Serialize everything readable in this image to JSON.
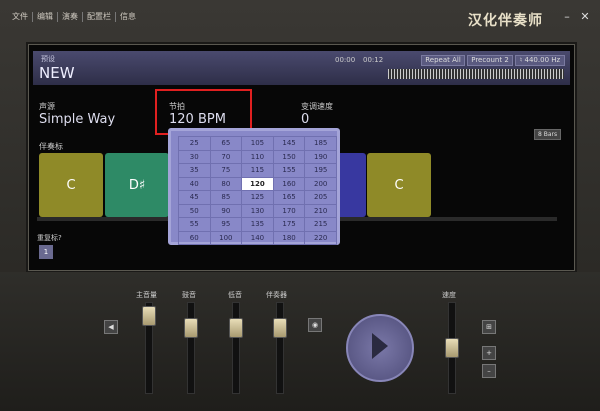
{
  "menu": [
    "文件",
    "编辑",
    "演奏",
    "配置栏",
    "信息"
  ],
  "app_title": "汉化伴奏师",
  "window_controls": {
    "minimize": "–",
    "close": "✕"
  },
  "header": {
    "preset_label": "预设",
    "preset_name": "NEW",
    "time_start": "00:00",
    "time_end": "00:12",
    "repeat_button": "Repeat All",
    "precount_button": "Precount 2",
    "tuning_button": "♮ 440.00 Hz"
  },
  "params": {
    "source_label": "声源",
    "source_value": "Simple Way",
    "beat_label": "节拍",
    "beat_value": "120 BPM",
    "speed_label": "变调速度",
    "speed_value": "0"
  },
  "bars_badge": "8 Bars",
  "accomp_label": "伴奏标",
  "chords": [
    {
      "name": "C",
      "color": "#8f8a28"
    },
    {
      "name": "D♯",
      "color": "#2e8a66"
    },
    {
      "name": "",
      "color": "#3838a0"
    },
    {
      "name": "C",
      "color": "#8f8a28"
    }
  ],
  "repeat_label": "重复标?",
  "repeat_value": "1",
  "tempo_grid": {
    "selected": "120",
    "rows": [
      [
        "25",
        "65",
        "105",
        "145",
        "185"
      ],
      [
        "30",
        "70",
        "110",
        "150",
        "190"
      ],
      [
        "35",
        "75",
        "115",
        "155",
        "195"
      ],
      [
        "40",
        "80",
        "120",
        "160",
        "200"
      ],
      [
        "45",
        "85",
        "125",
        "165",
        "205"
      ],
      [
        "50",
        "90",
        "130",
        "170",
        "210"
      ],
      [
        "55",
        "95",
        "135",
        "175",
        "215"
      ],
      [
        "60",
        "100",
        "140",
        "180",
        "220"
      ]
    ]
  },
  "mixer": {
    "main_volume": "主音量",
    "bass": "鼓音",
    "drums": "低音",
    "accomp": "伴奏器",
    "speed": "速度",
    "plus": "+",
    "minus": "–"
  }
}
